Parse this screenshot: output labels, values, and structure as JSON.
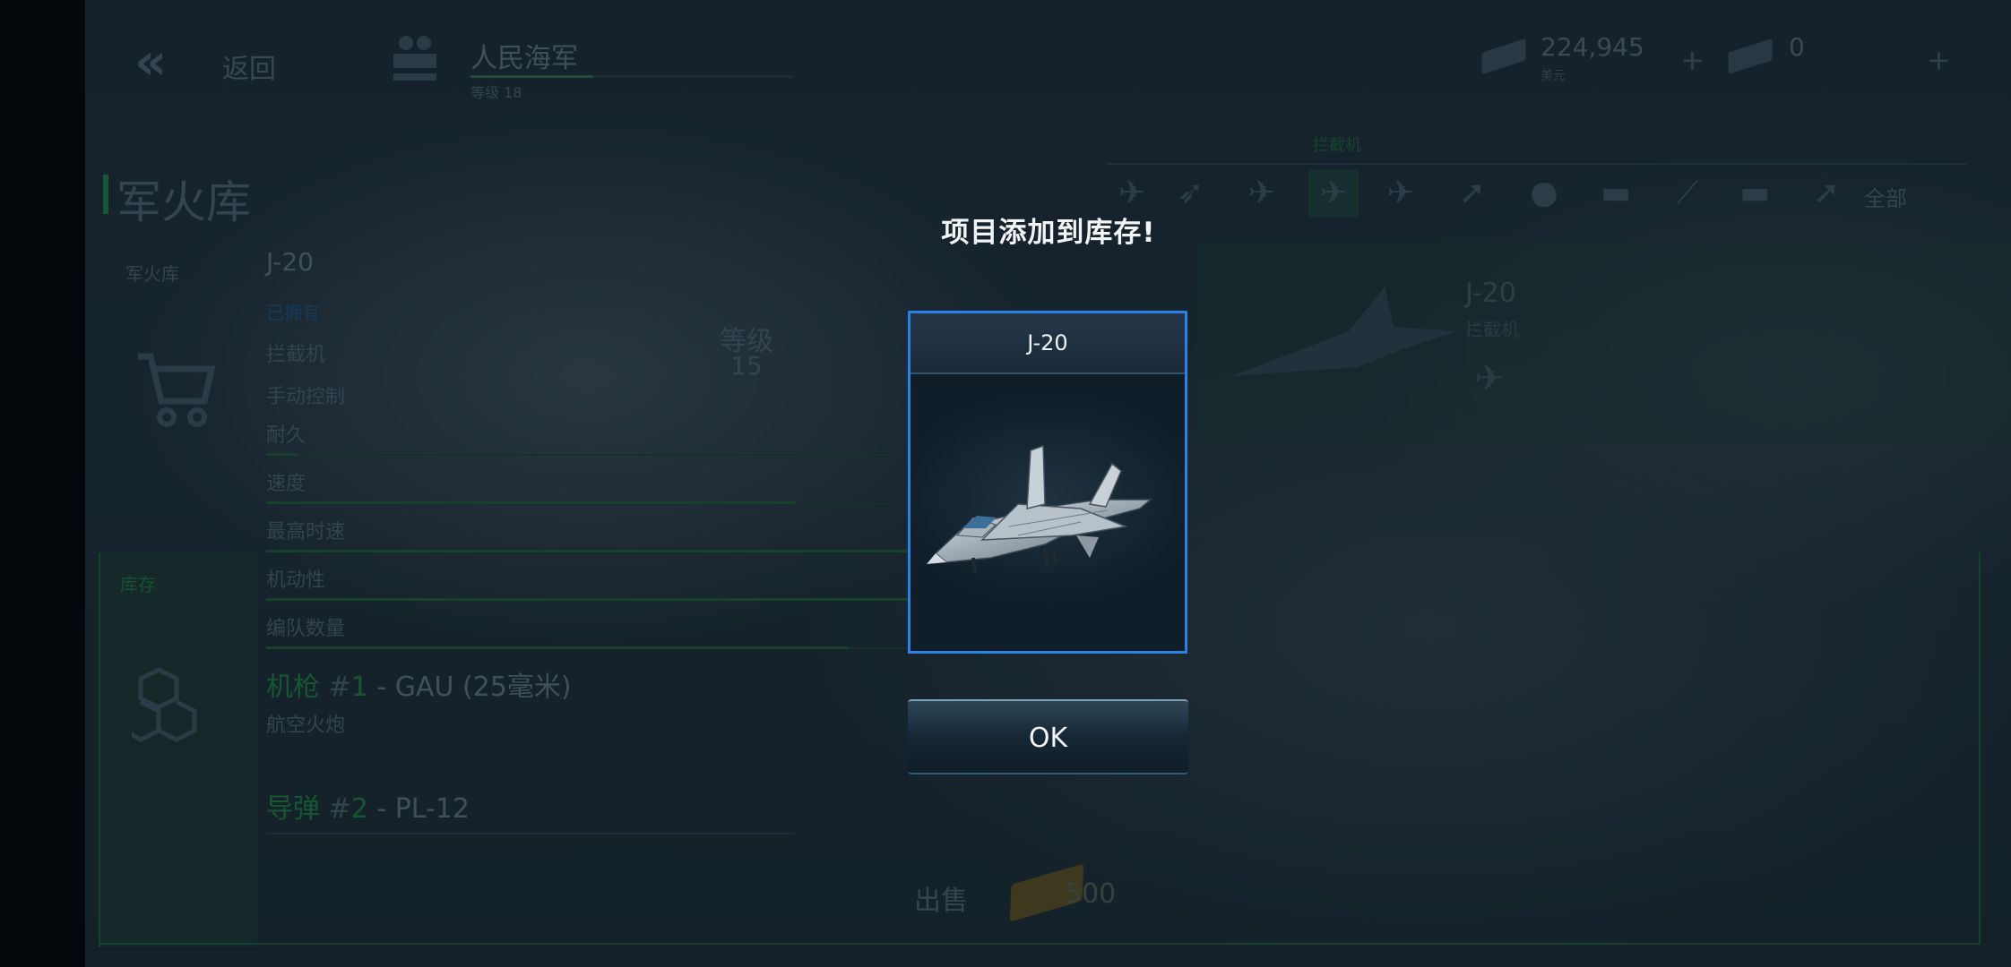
{
  "header": {
    "back_label": "返回",
    "faction_name": "人民海军",
    "faction_level": "等级 18",
    "faction_progress": 0.38,
    "currency_silver": "224,945",
    "currency_silver_label": "美元",
    "currency_gold": "0",
    "plus": "+"
  },
  "page_title": "军火库",
  "sidebar": {
    "arsenal_label": "军火库",
    "stock_label": "库存"
  },
  "filter": {
    "category_label": "拦截机",
    "all_label": "全部",
    "icons": [
      "jet-icon",
      "delta-jet-icon",
      "fighter-icon",
      "interceptor-icon",
      "bomber-icon",
      "missile-icon",
      "bomb-icon",
      "tank-icon",
      "sam-icon",
      "artillery-icon",
      "rocket-icon"
    ]
  },
  "selected_card": {
    "name": "J-20",
    "type": "拦截机"
  },
  "details": {
    "name": "J-20",
    "owned": "已拥有",
    "type": "拦截机",
    "control": "手动控制",
    "level_label": "等级",
    "level_value": "15",
    "stats": [
      {
        "label": "耐久",
        "value": 0.05
      },
      {
        "label": "速度",
        "value": 0.6
      },
      {
        "label": "最高时速",
        "value": 0.72
      },
      {
        "label": "机动性",
        "value": 0.78
      },
      {
        "label": "编队数量",
        "value": 0.6
      }
    ],
    "weapon1_type": "机枪",
    "weapon1_num": "1",
    "weapon1_name": "- GAU (25毫米)",
    "weapon1_desc": "航空火炮",
    "weapon2_type": "导弹",
    "weapon2_num": "2",
    "weapon2_name": "- PL-12"
  },
  "sell": {
    "label": "出售",
    "price": "500"
  },
  "dialog": {
    "title": "项目添加到库存!",
    "item_name": "J-20",
    "ok_label": "OK"
  },
  "colors": {
    "accent_blue": "#2b82e6",
    "accent_green": "#1d7a3c"
  }
}
